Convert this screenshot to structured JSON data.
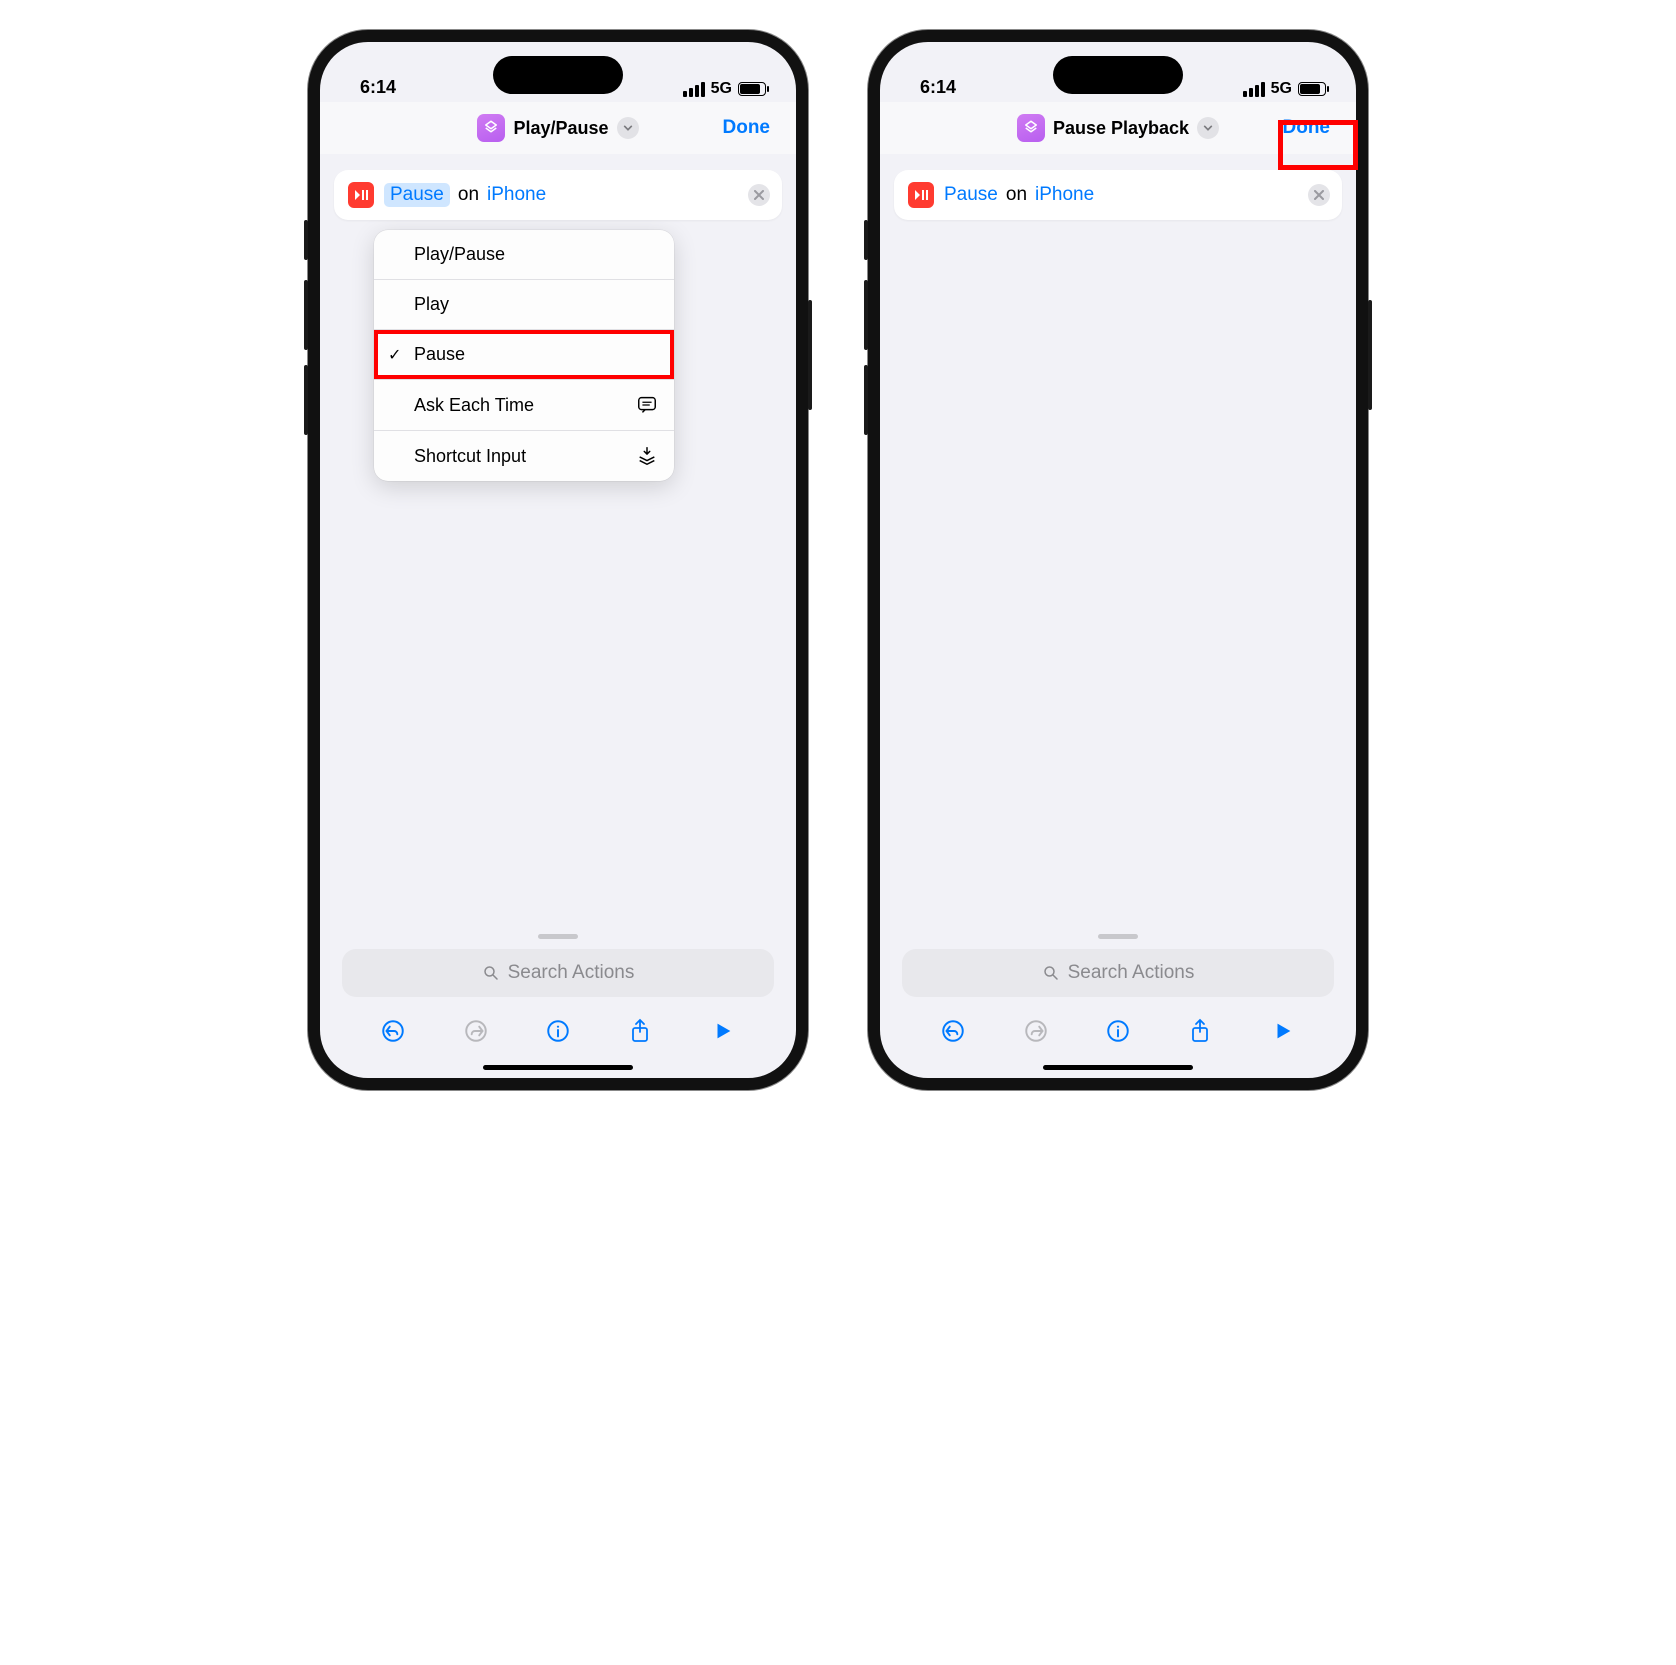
{
  "status": {
    "time": "6:14",
    "network": "5G"
  },
  "left": {
    "title": "Play/Pause",
    "done": "Done",
    "action": {
      "param": "Pause",
      "conn": "on",
      "device": "iPhone"
    },
    "menu": {
      "opt1": "Play/Pause",
      "opt2": "Play",
      "opt3": "Pause",
      "opt4": "Ask Each Time",
      "opt5": "Shortcut Input"
    }
  },
  "right": {
    "title": "Pause Playback",
    "done": "Done",
    "action": {
      "param": "Pause",
      "conn": "on",
      "device": "iPhone"
    }
  },
  "search_placeholder": "Search Actions"
}
